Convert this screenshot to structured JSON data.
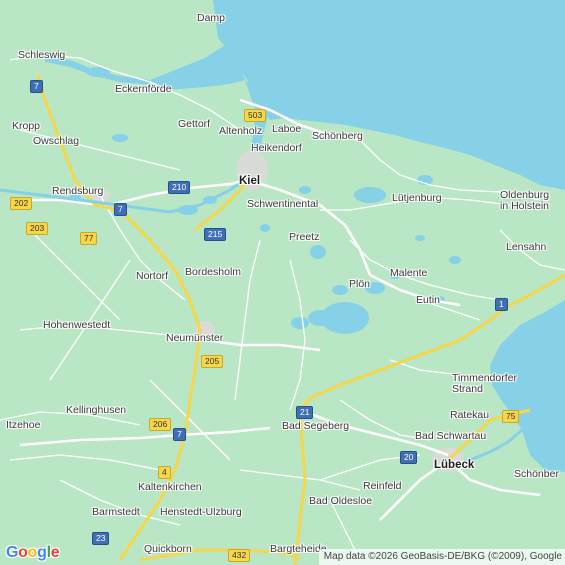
{
  "map": {
    "colors": {
      "land": "#b9e6c4",
      "water": "#86d1e7",
      "road": "#ffffff",
      "motorway": "#f7d64a"
    },
    "places": [
      {
        "name": "Damp",
        "bold": false
      },
      {
        "name": "Schleswig",
        "bold": false
      },
      {
        "name": "Eckernförde",
        "bold": false
      },
      {
        "name": "Gettorf",
        "bold": false
      },
      {
        "name": "Altenholz",
        "bold": false
      },
      {
        "name": "Laboe",
        "bold": false
      },
      {
        "name": "Schönberg",
        "bold": false
      },
      {
        "name": "Heikendorf",
        "bold": false
      },
      {
        "name": "Kropp",
        "bold": false
      },
      {
        "name": "Owschlag",
        "bold": false
      },
      {
        "name": "Kiel",
        "bold": true
      },
      {
        "name": "Rendsburg",
        "bold": false
      },
      {
        "name": "Schwentinental",
        "bold": false
      },
      {
        "name": "Lütjenburg",
        "bold": false
      },
      {
        "name": "Oldenburg\nin Holstein",
        "bold": false
      },
      {
        "name": "Preetz",
        "bold": false
      },
      {
        "name": "Lensahn",
        "bold": false
      },
      {
        "name": "Nortorf",
        "bold": false
      },
      {
        "name": "Bordesholm",
        "bold": false
      },
      {
        "name": "Malente",
        "bold": false
      },
      {
        "name": "Plön",
        "bold": false
      },
      {
        "name": "Eutin",
        "bold": false
      },
      {
        "name": "Hohenwestedt",
        "bold": false
      },
      {
        "name": "Neumünster",
        "bold": false
      },
      {
        "name": "Timmendorfer\nStrand",
        "bold": false
      },
      {
        "name": "Ratekau",
        "bold": false
      },
      {
        "name": "Kellinghusen",
        "bold": false
      },
      {
        "name": "Itzehoe",
        "bold": false
      },
      {
        "name": "Bad Segeberg",
        "bold": false
      },
      {
        "name": "Bad Schwartau",
        "bold": false
      },
      {
        "name": "Lübeck",
        "bold": true
      },
      {
        "name": "Schönber",
        "bold": false
      },
      {
        "name": "Kaltenkirchen",
        "bold": false
      },
      {
        "name": "Reinfeld",
        "bold": false
      },
      {
        "name": "Barmstedt",
        "bold": false
      },
      {
        "name": "Henstedt-Ulzburg",
        "bold": false
      },
      {
        "name": "Bad Oldesloe",
        "bold": false
      },
      {
        "name": "Quickborn",
        "bold": false
      },
      {
        "name": "Bargteheide",
        "bold": false
      }
    ],
    "shields": [
      {
        "label": "7",
        "kind": "auto"
      },
      {
        "label": "503",
        "kind": "fed"
      },
      {
        "label": "210",
        "kind": "auto"
      },
      {
        "label": "202",
        "kind": "fed"
      },
      {
        "label": "7",
        "kind": "auto"
      },
      {
        "label": "203",
        "kind": "fed"
      },
      {
        "label": "215",
        "kind": "auto"
      },
      {
        "label": "77",
        "kind": "fed"
      },
      {
        "label": "1",
        "kind": "auto"
      },
      {
        "label": "205",
        "kind": "fed"
      },
      {
        "label": "21",
        "kind": "auto"
      },
      {
        "label": "75",
        "kind": "fed"
      },
      {
        "label": "206",
        "kind": "fed"
      },
      {
        "label": "7",
        "kind": "auto"
      },
      {
        "label": "20",
        "kind": "auto"
      },
      {
        "label": "4",
        "kind": "fed"
      },
      {
        "label": "23",
        "kind": "auto"
      },
      {
        "label": "432",
        "kind": "fed"
      }
    ],
    "logo": "Google",
    "attribution": "Map data ©2026 GeoBasis-DE/BKG (©2009), Google"
  }
}
